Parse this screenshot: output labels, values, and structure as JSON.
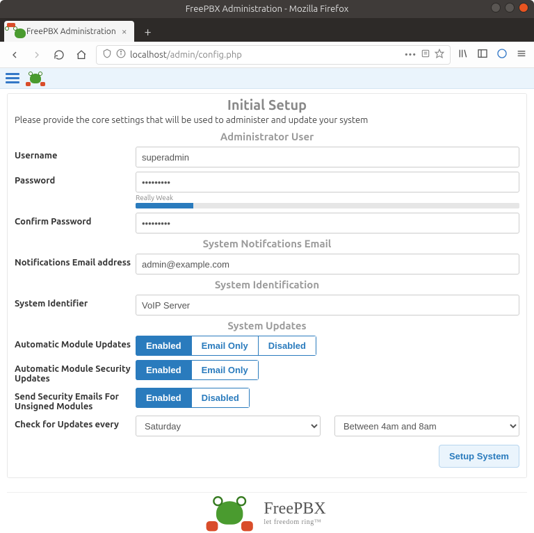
{
  "window": {
    "title": "FreePBX Administration - Mozilla Firefox"
  },
  "tab": {
    "label": "FreePBX Administration"
  },
  "address": {
    "host": "localhost",
    "path": "/admin/config.php"
  },
  "page": {
    "title": "Initial Setup",
    "subtitle": "Please provide the core settings that will be used to administer and update your system"
  },
  "sections": {
    "admin_user": "Administrator User",
    "notif_email": "System Notifcations Email",
    "sys_ident": "System Identification",
    "sys_updates": "System Updates"
  },
  "labels": {
    "username": "Username",
    "password": "Password",
    "confirm_password": "Confirm Password",
    "notif_email_addr": "Notifications Email address",
    "system_identifier": "System Identifier",
    "auto_module_updates": "Automatic Module Updates",
    "auto_module_sec_updates": "Automatic Module Security Updates",
    "send_sec_emails": "Send Security Emails For Unsigned Modules",
    "check_updates_every": "Check for Updates every"
  },
  "values": {
    "username": "superadmin",
    "password_masked": "•••••••••",
    "confirm_masked": "•••••••••",
    "notif_email": "admin@example.com",
    "system_identifier": "VoIP Server",
    "update_day": "Saturday",
    "update_window": "Between 4am and 8am"
  },
  "strength": {
    "label": "Really Weak",
    "percent": 15
  },
  "buttons": {
    "enabled": "Enabled",
    "email_only": "Email Only",
    "disabled": "Disabled",
    "setup_system": "Setup System"
  },
  "brand": {
    "name": "FreePBX",
    "tagline": "let freedom ring™"
  }
}
